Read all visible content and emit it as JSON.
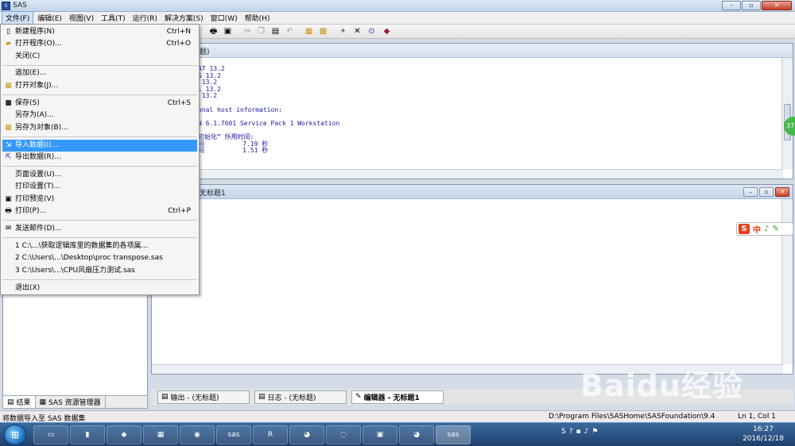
{
  "window": {
    "title": "SAS",
    "icon": "sas-app-icon"
  },
  "menubar": [
    "文件(F)",
    "编辑(E)",
    "视图(V)",
    "工具(T)",
    "运行(R)",
    "解决方案(S)",
    "窗口(W)",
    "帮助(H)"
  ],
  "file_menu": {
    "items": [
      {
        "label": "新建程序(N)",
        "shortcut": "Ctrl+N",
        "icon": "new-doc-icon"
      },
      {
        "label": "打开程序(O)...",
        "shortcut": "Ctrl+O",
        "icon": "open-folder-icon"
      },
      {
        "label": "关闭(C)",
        "shortcut": "",
        "icon": ""
      },
      {
        "label": "追加(E)...",
        "shortcut": "",
        "icon": ""
      },
      {
        "label": "打开对象(J)...",
        "shortcut": "",
        "icon": "open-object-icon"
      },
      {
        "label": "保存(S)",
        "shortcut": "Ctrl+S",
        "icon": "save-icon"
      },
      {
        "label": "另存为(A)...",
        "shortcut": "",
        "icon": ""
      },
      {
        "label": "另存为对象(B)...",
        "shortcut": "",
        "icon": "save-object-icon"
      },
      {
        "label": "导入数据(I)...",
        "shortcut": "",
        "icon": "import-icon"
      },
      {
        "label": "导出数据(R)...",
        "shortcut": "",
        "icon": "export-icon"
      },
      {
        "label": "页面设置(U)...",
        "shortcut": "",
        "icon": ""
      },
      {
        "label": "打印设置(T)...",
        "shortcut": "",
        "icon": ""
      },
      {
        "label": "打印预览(V)",
        "shortcut": "",
        "icon": "print-preview-icon"
      },
      {
        "label": "打印(P)...",
        "shortcut": "Ctrl+P",
        "icon": "print-icon"
      },
      {
        "label": "发送邮件(D)...",
        "shortcut": "",
        "icon": "mail-icon"
      },
      {
        "label": "1 C:\\...\\获取逻辑库里的数据集的各项属...",
        "shortcut": "",
        "icon": ""
      },
      {
        "label": "2 C:\\Users\\...\\Desktop\\proc transpose.sas",
        "shortcut": "",
        "icon": ""
      },
      {
        "label": "3 C:\\Users\\...\\CPU风扇压力测试.sas",
        "shortcut": "",
        "icon": ""
      },
      {
        "label": "退出(X)",
        "shortcut": "",
        "icon": ""
      }
    ]
  },
  "log_window": {
    "caption": "题)",
    "lines": [
      "AT 13.2",
      "S 13.2",
      " 13.2",
      "L 13.2",
      " 13.2",
      "",
      "onal host information:",
      "",
      "N 6.1.7601 Service Pack 1 Workstation",
      "",
      "初始化” 所用时间:",
      "间          7.19 秒",
      "间          1.51 秒"
    ]
  },
  "editor_window": {
    "caption": "无标题1"
  },
  "window_tabs": [
    {
      "label": "输出 - (无标题)",
      "icon": "output-icon"
    },
    {
      "label": "日志 - (无标题)",
      "icon": "log-icon"
    },
    {
      "label": "编辑器 - 无标题1",
      "icon": "editor-icon"
    }
  ],
  "left_tabs": [
    {
      "label": "结果",
      "icon": "results-icon"
    },
    {
      "label": "SAS 资源管理器",
      "icon": "explorer-icon"
    }
  ],
  "status": {
    "message": "将数据导入至 SAS 数据集",
    "path": "D:\\Program Files\\SASHome\\SASFoundation\\9.4",
    "position": "Ln 1, Col 1"
  },
  "ime": {
    "logo": "S",
    "mode": "中"
  },
  "badge": "37",
  "taskbar": {
    "apps": [
      "sas",
      "R",
      "sas"
    ],
    "clock_time": "16:27",
    "clock_date": "2016/12/18"
  },
  "watermark": "Baidu经验"
}
